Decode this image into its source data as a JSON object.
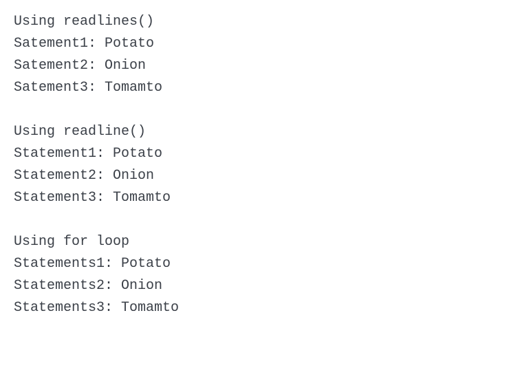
{
  "blocks": [
    {
      "header": "Using readlines()",
      "lines": [
        "Satement1: Potato",
        "Satement2: Onion",
        "Satement3: Tomamto"
      ]
    },
    {
      "header": "Using readline()",
      "lines": [
        "Statement1: Potato",
        "Statement2: Onion",
        "Statement3: Tomamto"
      ]
    },
    {
      "header": "Using for loop",
      "lines": [
        "Statements1: Potato",
        "Statements2: Onion",
        "Statements3: Tomamto"
      ]
    }
  ]
}
